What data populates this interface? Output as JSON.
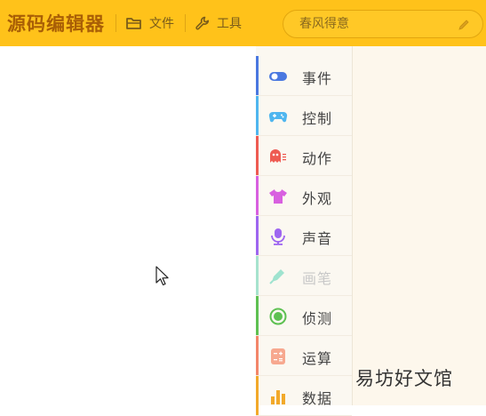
{
  "header": {
    "app_title": "源码编辑器",
    "file_label": "文件",
    "tools_label": "工具",
    "search_placeholder": "春风得意"
  },
  "categories": [
    {
      "label": "事件",
      "icon": "toggle-icon",
      "color": "#4a78e0",
      "disabled": false
    },
    {
      "label": "控制",
      "icon": "gamepad-icon",
      "color": "#4fb6ef",
      "disabled": false
    },
    {
      "label": "动作",
      "icon": "ghost-icon",
      "color": "#ee5b52",
      "disabled": false
    },
    {
      "label": "外观",
      "icon": "shirt-icon",
      "color": "#d860e0",
      "disabled": false
    },
    {
      "label": "声音",
      "icon": "microphone-icon",
      "color": "#9e66f0",
      "disabled": false
    },
    {
      "label": "画笔",
      "icon": "brush-icon",
      "color": "#3fc9a4",
      "disabled": true
    },
    {
      "label": "侦测",
      "icon": "target-icon",
      "color": "#5ec152",
      "disabled": false
    },
    {
      "label": "运算",
      "icon": "calculator-icon",
      "color": "#f3866a",
      "disabled": false
    },
    {
      "label": "数据",
      "icon": "bar-chart-icon",
      "color": "#f2a92a",
      "disabled": false
    }
  ],
  "watermark": "易坊好文馆"
}
